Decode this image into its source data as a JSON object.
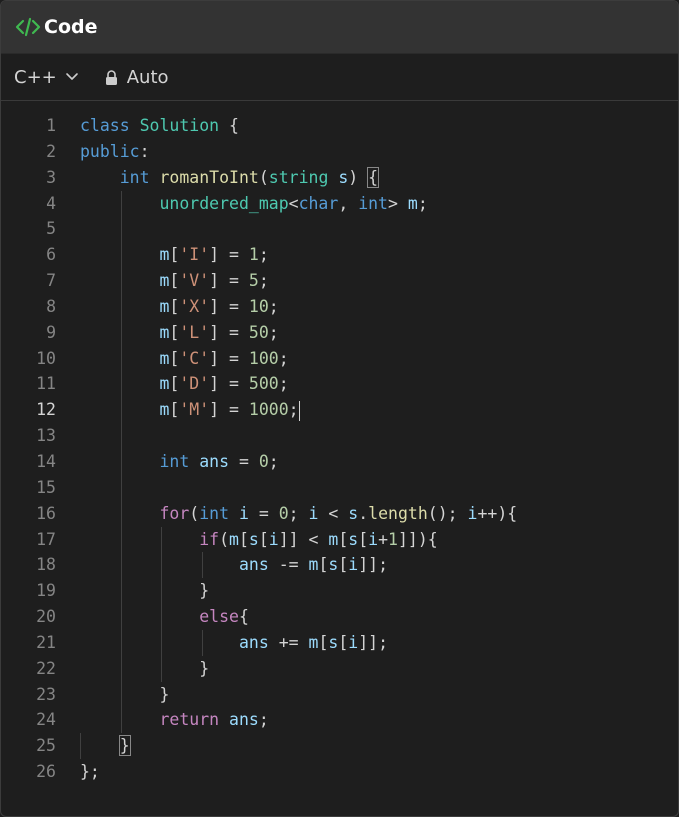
{
  "header": {
    "title": "Code",
    "icon": "code-icon"
  },
  "toolbar": {
    "language": "C++",
    "mode": "Auto"
  },
  "editor": {
    "active_line": 12,
    "lines": [
      {
        "n": "1",
        "html": "<span class=\"kw\">class</span> <span class=\"ty\">Solution</span> {"
      },
      {
        "n": "2",
        "html": "<span class=\"kw\">public</span>:"
      },
      {
        "n": "3",
        "html": "    <span class=\"kw\">int</span> <span class=\"fn\">romanToInt</span>(<span class=\"ty\">string</span> <span class=\"vr\">s</span>) <span class=\"br\">{</span>"
      },
      {
        "n": "4",
        "html": "        <span class=\"ty\">unordered_map</span>&lt;<span class=\"kw\">char</span>, <span class=\"kw\">int</span>&gt; <span class=\"vr\">m</span>;"
      },
      {
        "n": "5",
        "html": ""
      },
      {
        "n": "6",
        "html": "        <span class=\"vr\">m</span>[<span class=\"st\">'I'</span>] = <span class=\"nm\">1</span>;"
      },
      {
        "n": "7",
        "html": "        <span class=\"vr\">m</span>[<span class=\"st\">'V'</span>] = <span class=\"nm\">5</span>;"
      },
      {
        "n": "8",
        "html": "        <span class=\"vr\">m</span>[<span class=\"st\">'X'</span>] = <span class=\"nm\">10</span>;"
      },
      {
        "n": "9",
        "html": "        <span class=\"vr\">m</span>[<span class=\"st\">'L'</span>] = <span class=\"nm\">50</span>;"
      },
      {
        "n": "10",
        "html": "        <span class=\"vr\">m</span>[<span class=\"st\">'C'</span>] = <span class=\"nm\">100</span>;"
      },
      {
        "n": "11",
        "html": "        <span class=\"vr\">m</span>[<span class=\"st\">'D'</span>] = <span class=\"nm\">500</span>;"
      },
      {
        "n": "12",
        "html": "        <span class=\"vr\">m</span>[<span class=\"st\">'M'</span>] = <span class=\"nm\">1000</span>;<span class=\"cursor\"></span>"
      },
      {
        "n": "13",
        "html": ""
      },
      {
        "n": "14",
        "html": "        <span class=\"kw\">int</span> <span class=\"vr\">ans</span> = <span class=\"nm\">0</span>;"
      },
      {
        "n": "15",
        "html": ""
      },
      {
        "n": "16",
        "html": "        <span class=\"ctl\">for</span>(<span class=\"kw\">int</span> <span class=\"vr\">i</span> = <span class=\"nm\">0</span>; <span class=\"vr\">i</span> &lt; <span class=\"vr\">s</span>.<span class=\"fn\">length</span>(); <span class=\"vr\">i</span>++){"
      },
      {
        "n": "17",
        "html": "            <span class=\"ctl\">if</span>(<span class=\"vr\">m</span>[<span class=\"vr\">s</span>[<span class=\"vr\">i</span>]] &lt; <span class=\"vr\">m</span>[<span class=\"vr\">s</span>[<span class=\"vr\">i</span>+<span class=\"nm\">1</span>]]){"
      },
      {
        "n": "18",
        "html": "                <span class=\"vr\">ans</span> -= <span class=\"vr\">m</span>[<span class=\"vr\">s</span>[<span class=\"vr\">i</span>]];"
      },
      {
        "n": "19",
        "html": "            }"
      },
      {
        "n": "20",
        "html": "            <span class=\"ctl\">else</span>{"
      },
      {
        "n": "21",
        "html": "                <span class=\"vr\">ans</span> += <span class=\"vr\">m</span>[<span class=\"vr\">s</span>[<span class=\"vr\">i</span>]];"
      },
      {
        "n": "22",
        "html": "            }"
      },
      {
        "n": "23",
        "html": "        }"
      },
      {
        "n": "24",
        "html": "        <span class=\"ctl\">return</span> <span class=\"vr\">ans</span>;"
      },
      {
        "n": "25",
        "html": "    <span class=\"br\">}</span>"
      },
      {
        "n": "26",
        "html": "};"
      }
    ]
  },
  "colors": {
    "background": "#1e1e1e",
    "titlebar": "#333333",
    "keyword": "#569cd6",
    "control": "#c586c0",
    "type": "#4ec9b0",
    "function": "#dcdcaa",
    "string": "#ce9178",
    "number": "#b5cea8",
    "variable": "#9cdcfe",
    "icon_green": "#3fb950"
  }
}
